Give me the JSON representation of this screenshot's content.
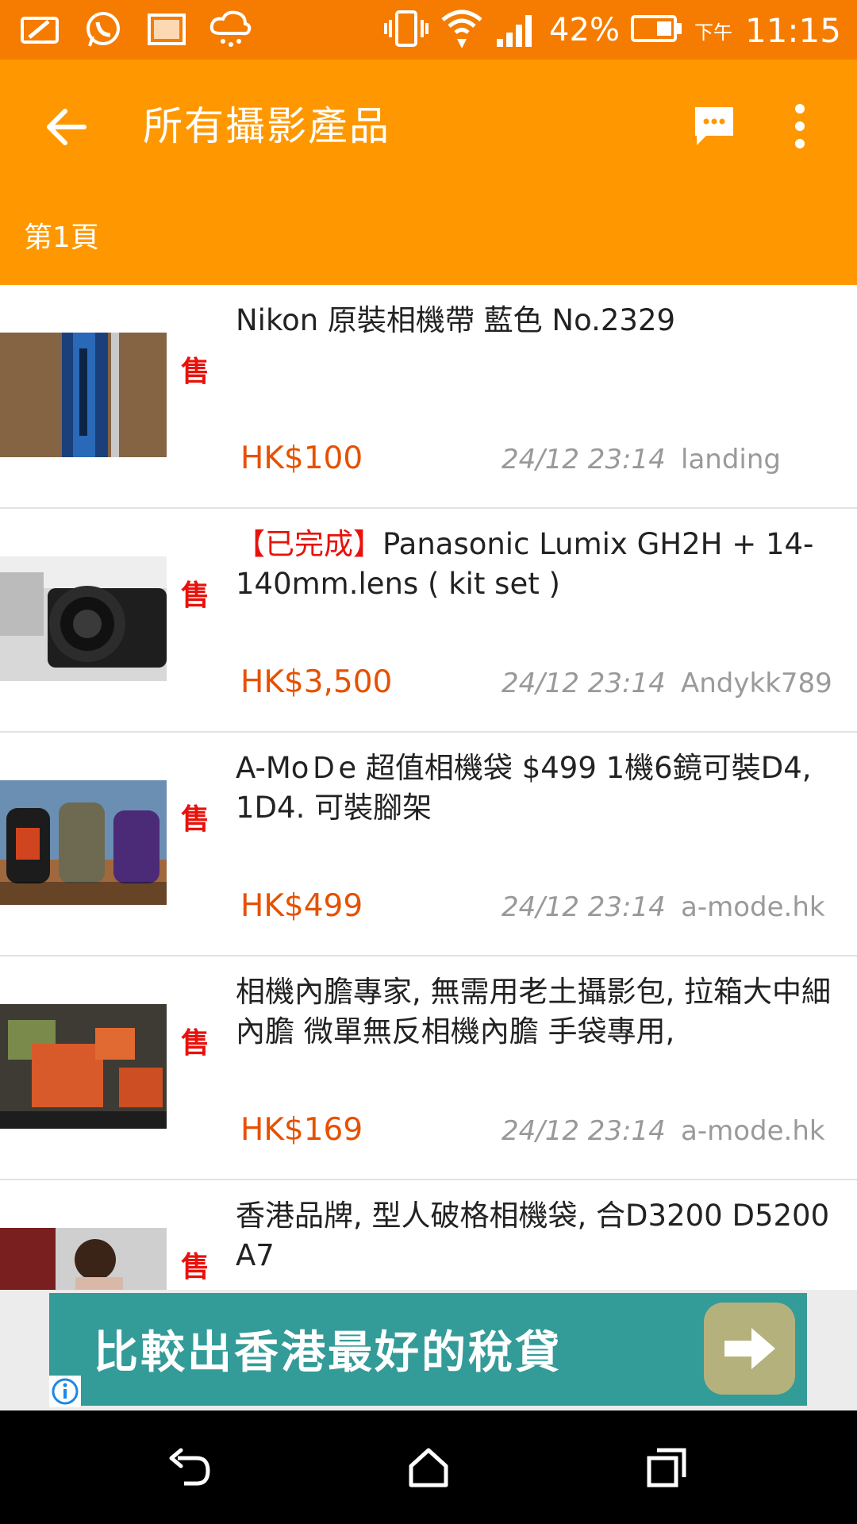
{
  "status_bar": {
    "icons": [
      "mail-icon",
      "whatsapp-icon",
      "image-icon",
      "weather-icon",
      "vibrate-icon",
      "wifi-icon",
      "signal-icon",
      "battery-icon"
    ],
    "battery_pct": "42%",
    "ampm": "下午",
    "time": "11:15"
  },
  "app_bar": {
    "title": "所有攝影產品",
    "page_label": "第1頁"
  },
  "listings": [
    {
      "sale_tag": "售",
      "status": "",
      "title": "Nikon 原裝相機帶 藍色 No.2329",
      "price": "HK$100",
      "date": "24/12 23:14",
      "user": "landing",
      "thumb": "strap"
    },
    {
      "sale_tag": "售",
      "status": "【已完成】",
      "title": "Panasonic Lumix GH2H + 14-140mm.lens ( kit set )",
      "price": "HK$3,500",
      "date": "24/12 23:14",
      "user": "Andykk789",
      "thumb": "camera"
    },
    {
      "sale_tag": "售",
      "status": "",
      "title": "A-MoＤe 超值相機袋 $499 1機6鏡可裝D4, 1D4. 可裝腳架",
      "price": "HK$499",
      "date": "24/12 23:14",
      "user": "a-mode.hk",
      "thumb": "bags"
    },
    {
      "sale_tag": "售",
      "status": "",
      "title": "相機內膽專家, 無需用老土攝影包, 拉箱大中細 內膽 微單無反相機內膽 手袋專用,",
      "price": "HK$169",
      "date": "24/12 23:14",
      "user": "a-mode.hk",
      "thumb": "inserts"
    },
    {
      "sale_tag": "售",
      "status": "",
      "title": "香港品牌, 型人破格相機袋, 合D3200 D5200 A7",
      "price": "",
      "date": "",
      "user": "",
      "thumb": "model"
    }
  ],
  "ad": {
    "text": "比較出香港最好的稅貸"
  },
  "colors": {
    "status_bar": "#f57c00",
    "app_bar": "#ff9800",
    "price": "#e65100",
    "sale_tag": "#e8120c",
    "ad_bg": "#339b98"
  }
}
